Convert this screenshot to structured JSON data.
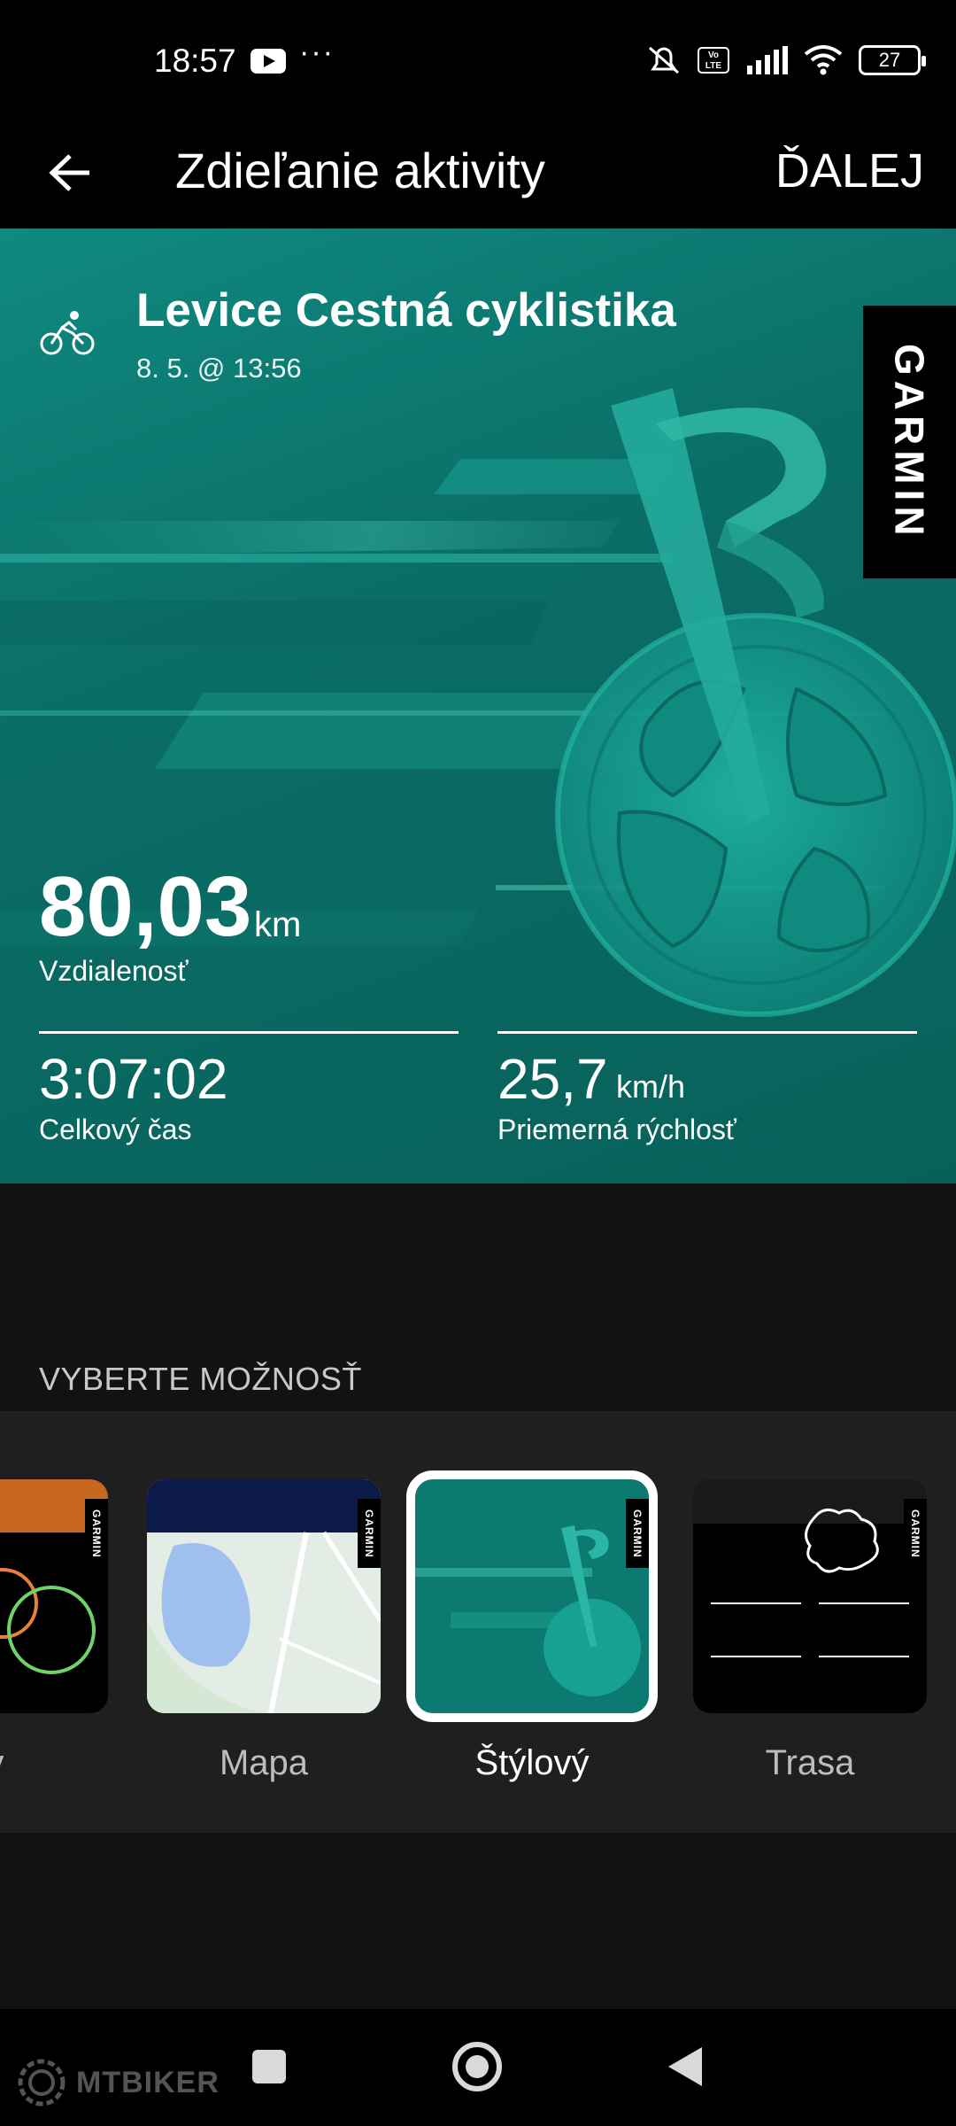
{
  "status_bar": {
    "time": "18:57",
    "more": "···",
    "battery": "27",
    "volte": "Vo LTE",
    "icons": [
      "youtube-icon",
      "mute-icon",
      "volte-icon",
      "signal-icon",
      "wifi-icon",
      "battery-icon"
    ]
  },
  "header": {
    "title": "Zdieľanie aktivity",
    "next_label": "ĎALEJ"
  },
  "card": {
    "activity_title": "Levice Cestná cyklistika",
    "date": "8. 5. @ 13:56",
    "brand": "GARMIN",
    "distance_value": "80,03",
    "distance_unit": "km",
    "distance_label": "Vzdialenosť",
    "time_value": "3:07:02",
    "time_label": "Celkový čas",
    "speed_value": "25,7",
    "speed_unit": "km/h",
    "speed_label": "Priemerná rýchlosť",
    "colors": {
      "accent": "#0d8078",
      "wheel": "#18a79a"
    }
  },
  "options": {
    "heading": "VYBERTE MOŽNOSŤ",
    "items": [
      {
        "label": "ický",
        "selected": false
      },
      {
        "label": "Mapa",
        "selected": false
      },
      {
        "label": "Štýlový",
        "selected": true
      },
      {
        "label": "Trasa",
        "selected": false
      }
    ],
    "thumb_brand": "GARMIN"
  },
  "watermark": {
    "text": "MTBIKER"
  }
}
